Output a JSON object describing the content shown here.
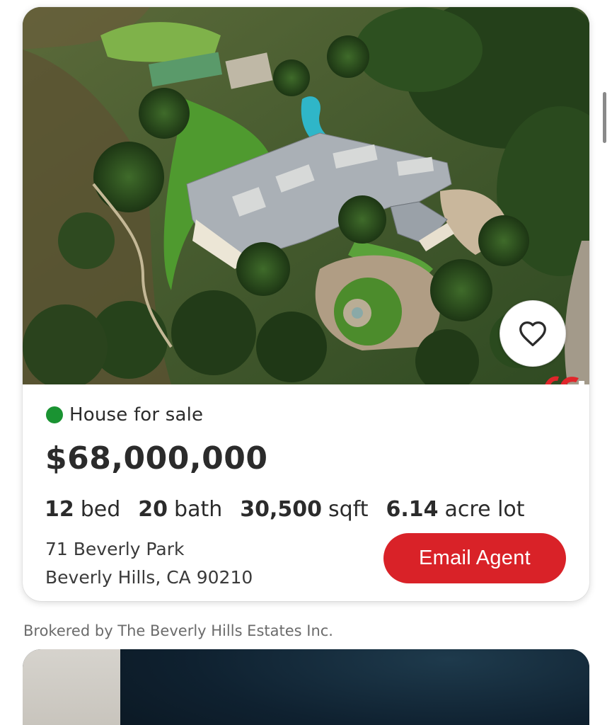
{
  "listing": {
    "status_label": "House for sale",
    "status_color": "#1a9332",
    "price": "$68,000,000",
    "facts": [
      {
        "value": "12",
        "unit": "bed"
      },
      {
        "value": "20",
        "unit": "bath"
      },
      {
        "value": "30,500",
        "unit": "sqft"
      },
      {
        "value": "6.14",
        "unit": "acre lot"
      }
    ],
    "address_line1": "71 Beverly Park",
    "address_line2": "Beverly Hills, CA 90210",
    "email_agent_label": "Email Agent",
    "accent_color": "#d92228",
    "favorite_icon": "heart-outline-icon",
    "photo_description": "Aerial view of mansion estate"
  },
  "broker": {
    "text": "Brokered by The Beverly Hills Estates Inc."
  }
}
